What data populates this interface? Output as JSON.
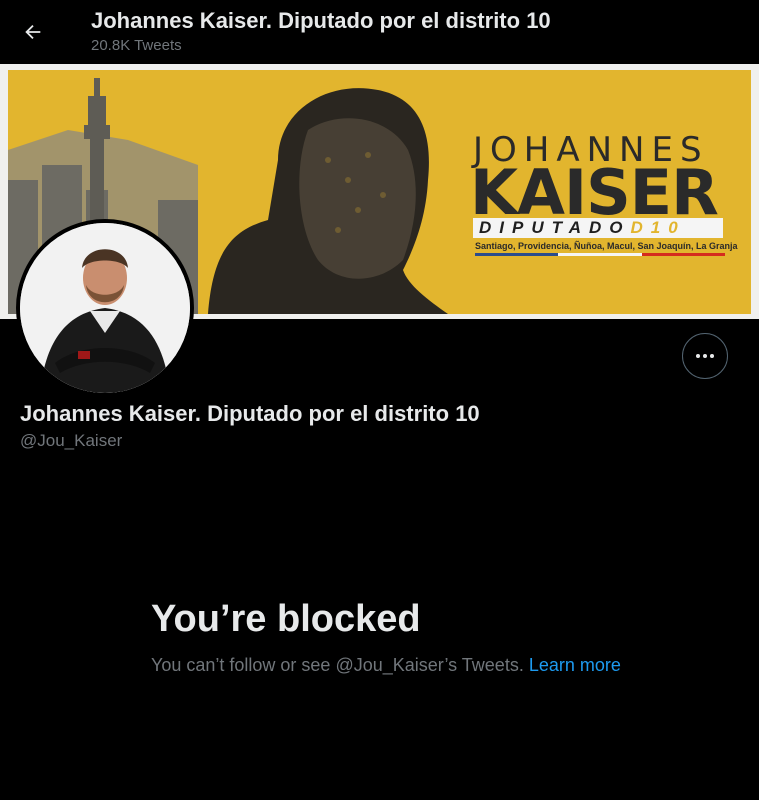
{
  "header": {
    "title": "Johannes Kaiser. Diputado por el distrito 10",
    "tweet_count": "20.8K Tweets",
    "back_icon": "arrow-left-icon"
  },
  "banner": {
    "first_name": "JOHANNES",
    "last_name": "KAISER",
    "role": "DIPUTADO",
    "district": "D10",
    "communes": "Santiago, Providencia, Ñuñoa, Macul, San Joaquín, La Granja",
    "bg_color": "#e2b52e"
  },
  "profile": {
    "name": "Johannes Kaiser. Diputado por el distrito 10",
    "handle": "@Jou_Kaiser",
    "more_icon": "more-horizontal-icon"
  },
  "blocked": {
    "title": "You’re blocked",
    "message": "You can’t follow or see @Jou_Kaiser’s Tweets.",
    "link_label": "Learn more",
    "link_color": "#1d9bf0"
  }
}
